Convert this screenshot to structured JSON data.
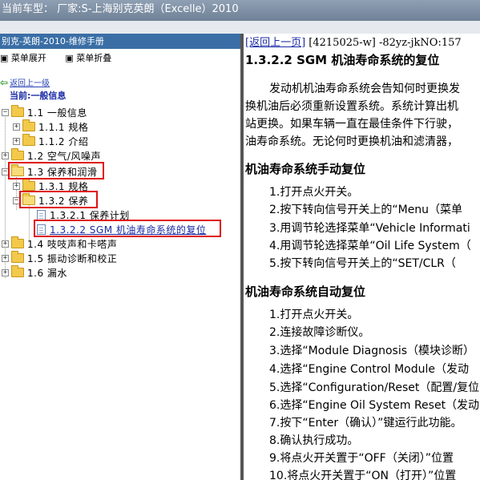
{
  "titlebar": {
    "text": "当前车型：  厂家:S-上海别克英朗（Excelle）2010"
  },
  "left_panel": {
    "title": "别克-英朗-2010-维修手册",
    "tools": {
      "expand": "菜单展开",
      "collapse": "菜单折叠"
    },
    "back_link": "返回上一级",
    "current": "当前:一般信息",
    "tree": [
      {
        "label": "1.1 一般信息"
      },
      {
        "label": "1.1.1 规格"
      },
      {
        "label": "1.1.2 介绍"
      },
      {
        "label": "1.2 空气/风噪声"
      },
      {
        "label": "1.3 保养和润滑"
      },
      {
        "label": "1.3.1 规格"
      },
      {
        "label": "1.3.2 保养"
      },
      {
        "label": "1.3.2.1 保养计划"
      },
      {
        "label": "1.3.2.2 SGM 机油寿命系统的复位"
      },
      {
        "label": "1.4 吱吱声和卡嗒声"
      },
      {
        "label": "1.5 振动诊断和校正"
      },
      {
        "label": "1.6 漏水"
      }
    ]
  },
  "right_panel": {
    "back_link": "[返回上一页]",
    "doc_id": "[4215025-w] -82yz-jkNO:157",
    "title": "1.3.2.2 SGM 机油寿命系统的复位",
    "intro": [
      "发动机机油寿命系统会告知何时更换发",
      "换机油后必须重新设置系统。系统计算出机",
      "站更换。如果车辆一直在最佳条件下行驶，",
      "油寿命系统。无论何时更换机油和滤清器，"
    ],
    "manual_title": "机油寿命系统手动复位",
    "manual_steps": [
      "1.打开点火开关。",
      "2.按下转向信号开关上的“Menu（菜单",
      "3.用调节轮选择菜单“Vehicle Informati",
      "4.用调节轮选择菜单“Oil Life System（",
      "5.按下转向信号开关上的“SET/CLR（"
    ],
    "auto_title": "机油寿命系统自动复位",
    "auto_steps": [
      "1.打开点火开关。",
      "2.连接故障诊断仪。",
      "3.选择“Module Diagnosis（模块诊断）",
      "4.选择“Engine Control Module（发动",
      "5.选择“Configuration/Reset（配置/复位",
      "6.选择“Engine Oil System Reset（发动",
      "7.按下“Enter（确认）”键运行此功能。",
      "8.确认执行成功。",
      "9.将点火开关置于“OFF（关闭）”位置",
      "10.将点火开关置于“ON（打开）”位置"
    ]
  }
}
